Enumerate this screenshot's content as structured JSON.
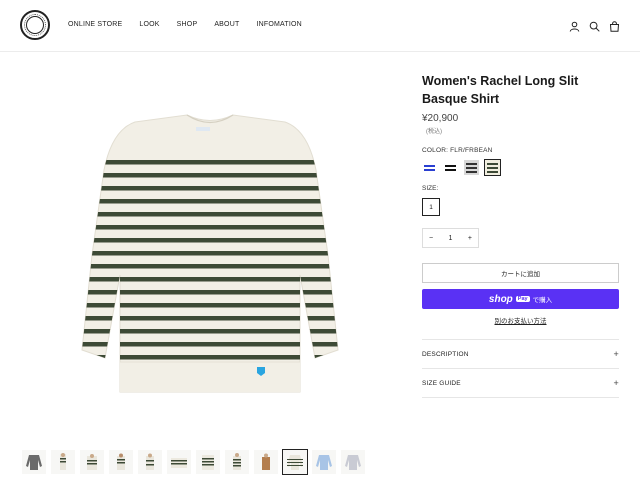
{
  "header": {
    "logo_text": "ORCIVAL",
    "nav": [
      "ONLINE STORE",
      "LOOK",
      "SHOP",
      "ABOUT",
      "INFOMATION"
    ],
    "icons": [
      "account-icon",
      "search-icon",
      "cart-icon"
    ]
  },
  "product": {
    "title": "Women's Rachel Long Slit Basque Shirt",
    "price": "¥20,900",
    "tax_note": "(税込)",
    "color_label": "COLOR: FLR/FRBEAN",
    "swatches": [
      {
        "name": "blue-stripe",
        "bg": "#ffffff",
        "stripe": "#2a3fd1",
        "selected": false
      },
      {
        "name": "black-stripe",
        "bg": "#ffffff",
        "stripe": "#111111",
        "selected": false
      },
      {
        "name": "grey-stripe",
        "bg": "#d8d8d8",
        "stripe": "#333333",
        "selected": false
      },
      {
        "name": "green-stripe",
        "bg": "#f1eedf",
        "stripe": "#3d4a36",
        "selected": true
      }
    ],
    "size_label": "SIZE:",
    "size_value": "1",
    "quantity": "1",
    "qty_minus": "−",
    "qty_plus": "+",
    "add_to_cart": "カートに追加",
    "shop_pay_word": "shop",
    "shop_pay_badge": "Pay",
    "shop_pay_suffix": "で購入",
    "more_payment": "別のお支払い方法",
    "accordions": [
      {
        "label": "DESCRIPTION",
        "icon": "+"
      },
      {
        "label": "SIZE GUIDE",
        "icon": "+"
      }
    ]
  },
  "colors": {
    "shirt_body": "#f2efe6",
    "stripe_green": "#3d4a36",
    "shop_pay": "#5a31f4",
    "logo_patch": "#2aa5e0"
  },
  "thumbnails_count": 12,
  "active_thumbnail": 9
}
